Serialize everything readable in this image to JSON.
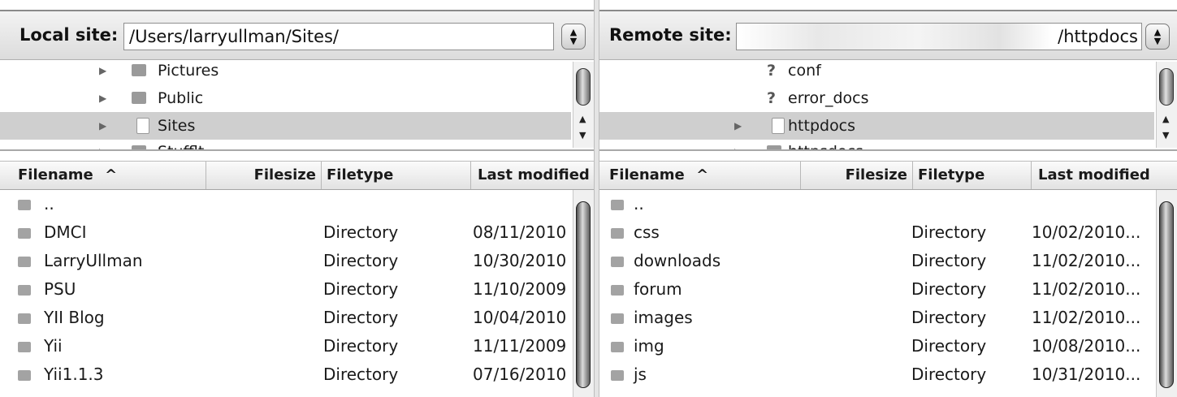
{
  "local": {
    "site_label": "Local site:",
    "path": "/Users/larryullman/Sites/",
    "tree": [
      {
        "label": "Pictures",
        "selected": false
      },
      {
        "label": "Public",
        "selected": false
      },
      {
        "label": "Sites",
        "selected": true
      },
      {
        "label": "Stufflt",
        "selected": false
      }
    ],
    "columns": {
      "filename": "Filename",
      "filesize": "Filesize",
      "filetype": "Filetype",
      "modified": "Last modified"
    },
    "sort_indicator": "^",
    "files": [
      {
        "name": "..",
        "type": "",
        "modified": ""
      },
      {
        "name": "DMCI",
        "type": "Directory",
        "modified": "08/11/2010"
      },
      {
        "name": "LarryUllman",
        "type": "Directory",
        "modified": "10/30/2010"
      },
      {
        "name": "PSU",
        "type": "Directory",
        "modified": "11/10/2009"
      },
      {
        "name": "YII Blog",
        "type": "Directory",
        "modified": "10/04/2010"
      },
      {
        "name": "Yii",
        "type": "Directory",
        "modified": "11/11/2009"
      },
      {
        "name": "Yii1.1.3",
        "type": "Directory",
        "modified": "07/16/2010"
      }
    ]
  },
  "remote": {
    "site_label": "Remote site:",
    "path": "/httpdocs",
    "tree": [
      {
        "label": "conf",
        "selected": false
      },
      {
        "label": "error_docs",
        "selected": false
      },
      {
        "label": "httpdocs",
        "selected": true
      },
      {
        "label": "httpsdocs",
        "selected": false
      }
    ],
    "columns": {
      "filename": "Filename",
      "filesize": "Filesize",
      "filetype": "Filetype",
      "modified": "Last modified"
    },
    "sort_indicator": "^",
    "files": [
      {
        "name": "..",
        "type": "",
        "modified": ""
      },
      {
        "name": "css",
        "type": "Directory",
        "modified": "10/02/2010..."
      },
      {
        "name": "downloads",
        "type": "Directory",
        "modified": "11/02/2010..."
      },
      {
        "name": "forum",
        "type": "Directory",
        "modified": "11/02/2010..."
      },
      {
        "name": "images",
        "type": "Directory",
        "modified": "11/02/2010..."
      },
      {
        "name": "img",
        "type": "Directory",
        "modified": "10/08/2010..."
      },
      {
        "name": "js",
        "type": "Directory",
        "modified": "10/31/2010..."
      }
    ]
  }
}
